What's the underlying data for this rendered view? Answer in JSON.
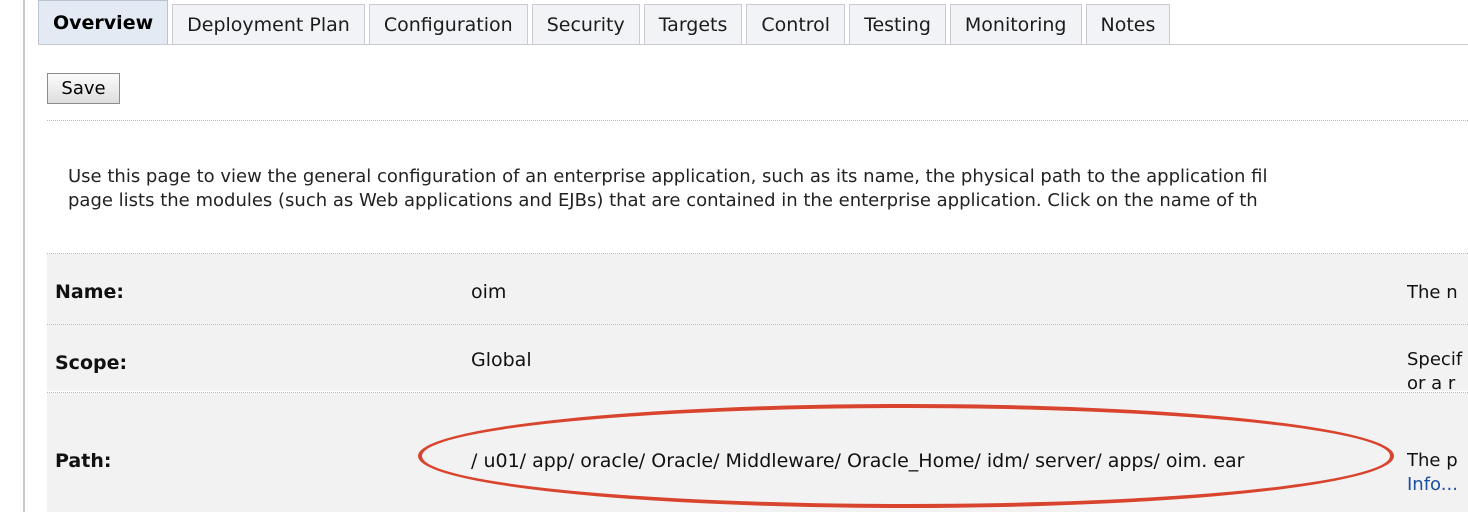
{
  "tabs": [
    {
      "label": "Overview",
      "active": true
    },
    {
      "label": "Deployment Plan"
    },
    {
      "label": "Configuration"
    },
    {
      "label": "Security"
    },
    {
      "label": "Targets"
    },
    {
      "label": "Control"
    },
    {
      "label": "Testing"
    },
    {
      "label": "Monitoring"
    },
    {
      "label": "Notes"
    }
  ],
  "toolbar": {
    "save_label": "Save"
  },
  "description": {
    "line1": "Use this page to view the general configuration of an enterprise application, such as its name, the physical path to the application fil",
    "line2": "page lists the modules (such as Web applications and EJBs) that are contained in the enterprise application. Click on the name of th"
  },
  "fields": {
    "name": {
      "label": "Name:",
      "value": "oim",
      "help": "The n"
    },
    "scope": {
      "label": "Scope:",
      "value": "Global",
      "help_line1": "Specif",
      "help_line2": "or a r"
    },
    "path": {
      "label": "Path:",
      "value": "/ u01/ app/ oracle/ Oracle/ Middleware/ Oracle_Home/ idm/ server/ apps/ oim. ear",
      "help_line1": "The p",
      "help_link": "Info..."
    }
  },
  "colors": {
    "annotation": "#d9442e",
    "link": "#1b4fa3",
    "row_background": "#f2f2f2",
    "active_tab": "#e3eaf3"
  }
}
